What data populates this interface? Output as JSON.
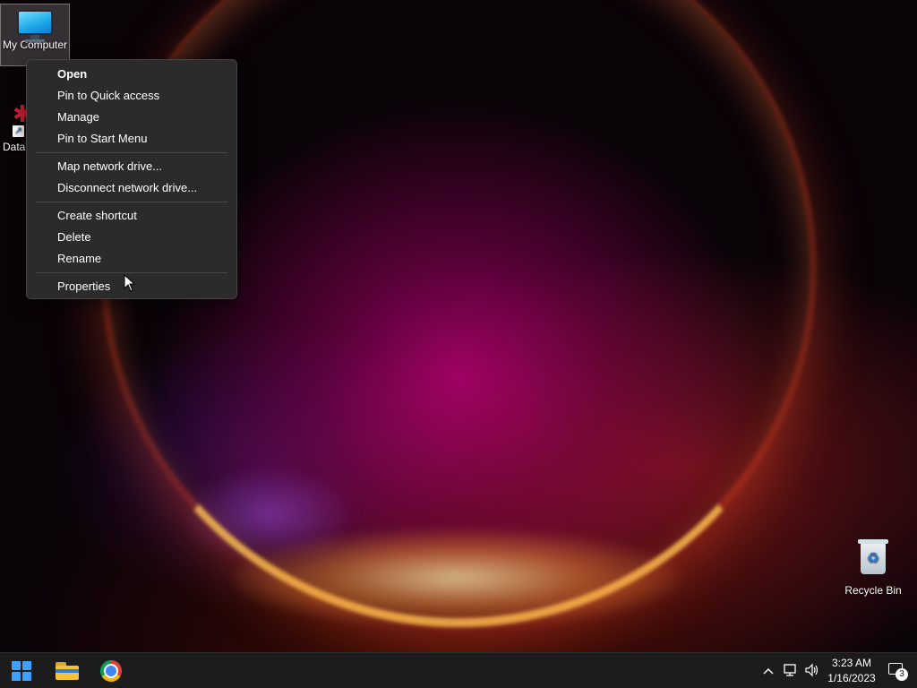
{
  "desktop": {
    "icons": {
      "my_computer": {
        "label": "My Computer",
        "icon": "monitor-icon"
      },
      "dataw": {
        "label": "DataV",
        "icon": "dataw-app-icon"
      },
      "recycle_bin": {
        "label": "Recycle Bin",
        "icon": "recycle-bin-icon"
      }
    }
  },
  "context_menu": {
    "groups": [
      [
        "Open",
        "Pin to Quick access",
        "Manage",
        "Pin to Start Menu"
      ],
      [
        "Map network drive...",
        "Disconnect network drive..."
      ],
      [
        "Create shortcut",
        "Delete",
        "Rename"
      ],
      [
        "Properties"
      ]
    ],
    "default_item": "Open"
  },
  "taskbar": {
    "pinned": [
      {
        "name": "start-button",
        "icon": "windows-logo-icon"
      },
      {
        "name": "file-explorer",
        "icon": "folder-icon"
      },
      {
        "name": "chrome",
        "icon": "chrome-icon"
      }
    ],
    "tray": {
      "overflow_icon": "chevron-up-icon",
      "network_icon": "network-icon",
      "volume_icon": "volume-icon",
      "time": "3:23 AM",
      "date": "1/16/2023",
      "notification_count": "3"
    }
  },
  "colors": {
    "accent": "#3fa1ff",
    "menu_bg": "#2b2b2b",
    "taskbar_bg": "#1c1c1c"
  }
}
